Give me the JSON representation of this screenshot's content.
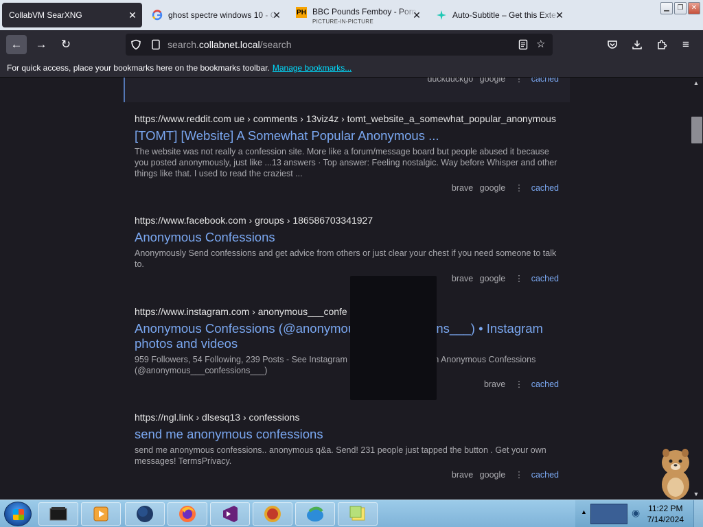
{
  "tabs": [
    {
      "title": "CollabVM SearXNG",
      "active": true,
      "icon": "none"
    },
    {
      "title": "ghost spectre windows 10 - G",
      "icon": "google-icon"
    },
    {
      "title": "BBC Pounds Femboy - Porn",
      "subtitle": "PICTURE-IN-PICTURE",
      "icon": "ph-icon"
    },
    {
      "title": "Auto-Subtitle – Get this Exte",
      "icon": "extension-icon"
    }
  ],
  "toolbar": {
    "url_prefix": "search.",
    "url_domain": "collabnet.local",
    "url_path": "/search"
  },
  "bookmarks": {
    "text": "For quick access, place your bookmarks here on the bookmarks toolbar.",
    "link": "Manage bookmarks..."
  },
  "top_card": {
    "engines": [
      "duckduckgo",
      "google"
    ],
    "cached": "cached"
  },
  "results": [
    {
      "url_host": "https://www.reddit.com",
      "url_path": " ue › comments › 13viz4z › tomt_website_a_somewhat_popular_anonymous",
      "title": "[TOMT] [Website] A Somewhat Popular Anonymous ...",
      "desc": "The website was not really a confession site. More like a forum/message board but people abused it because you posted anonymously, just like ...13 answers · Top answer: Feeling nostalgic. Way before Whisper and other things like that. I used to read the craziest ...",
      "engines": [
        "brave",
        "google"
      ],
      "cached": "cached"
    },
    {
      "url_host": "https://www.facebook.com",
      "url_path": " › groups › 186586703341927",
      "title": "Anonymous Confessions",
      "desc": "Anonymously Send confessions and get advice from others or just clear your chest if you need someone to talk to.",
      "engines": [
        "brave",
        "google"
      ],
      "cached": "cached"
    },
    {
      "url_host": "https://www.instagram.com",
      "url_path": " › anonymous___confe",
      "title": "Anonymous Confessions (@anonymous___confessions___) • Instagram photos and videos",
      "desc": "959 Followers, 54 Following, 239 Posts - See Instagram photos and videos from Anonymous Confessions (@anonymous___confessions___)",
      "engines": [
        "brave"
      ],
      "cached": "cached"
    },
    {
      "url_host": "https://ngl.link",
      "url_path": " › dlsesq13 › confessions",
      "title": "send me anonymous confessions",
      "desc": "send me anonymous confessions.. anonymous q&a. Send! 231 people just tapped the button . Get your own messages! TermsPrivacy.",
      "engines": [
        "brave",
        "google"
      ],
      "cached": "cached"
    }
  ],
  "clock": {
    "time": "11:22 PM",
    "date": "7/14/2024"
  },
  "colors": {
    "link": "#7aa7f0",
    "page_bg": "#1c1b22",
    "chrome_bg": "#2b2a33"
  }
}
